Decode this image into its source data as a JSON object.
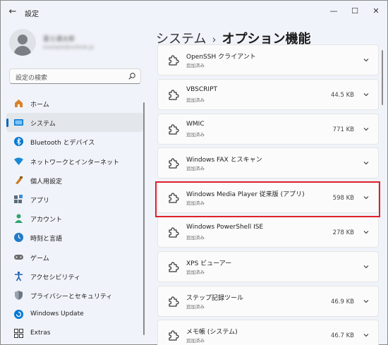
{
  "window": {
    "title": "設定",
    "minimize": "—",
    "maximize": "☐",
    "close": "✕",
    "back": "←"
  },
  "user": {
    "name": "富士通太郎",
    "email": "example@outlook.jp"
  },
  "search": {
    "placeholder": "設定の検索"
  },
  "nav": [
    {
      "label": "ホーム",
      "icon": "home-icon",
      "color": "#d9822b"
    },
    {
      "label": "システム",
      "icon": "system-icon",
      "color": "#0078d4",
      "active": true
    },
    {
      "label": "Bluetooth とデバイス",
      "icon": "bluetooth-icon",
      "color": "#0078d4"
    },
    {
      "label": "ネットワークとインターネット",
      "icon": "network-icon",
      "color": "#1a8ad4"
    },
    {
      "label": "個人用設定",
      "icon": "personalization-icon",
      "color": "#c97a22"
    },
    {
      "label": "アプリ",
      "icon": "apps-icon",
      "color": "#5a6b7b"
    },
    {
      "label": "アカウント",
      "icon": "account-icon",
      "color": "#2aa56b"
    },
    {
      "label": "時刻と言語",
      "icon": "time-language-icon",
      "color": "#1f7ac8"
    },
    {
      "label": "ゲーム",
      "icon": "gaming-icon",
      "color": "#6b6b6b"
    },
    {
      "label": "アクセシビリティ",
      "icon": "accessibility-icon",
      "color": "#1a5fb4"
    },
    {
      "label": "プライバシーとセキュリティ",
      "icon": "privacy-shield-icon",
      "color": "#6e7781"
    },
    {
      "label": "Windows Update",
      "icon": "windows-update-icon",
      "color": "#0078d4"
    },
    {
      "label": "Extras",
      "icon": "extras-icon",
      "color": "#333333"
    }
  ],
  "header": {
    "parent": "システム",
    "separator": "›",
    "current": "オプション機能"
  },
  "features": [
    {
      "name": "OpenSSH クライアント",
      "status": "追加済み",
      "size": ""
    },
    {
      "name": "VBSCRIPT",
      "status": "追加済み",
      "size": "44.5 KB"
    },
    {
      "name": "WMIC",
      "status": "追加済み",
      "size": "771 KB"
    },
    {
      "name": "Windows FAX とスキャン",
      "status": "追加済み",
      "size": ""
    },
    {
      "name": "Windows Media Player 従来版 (アプリ)",
      "status": "追加済み",
      "size": "598 KB",
      "highlighted": true
    },
    {
      "name": "Windows PowerShell ISE",
      "status": "追加済み",
      "size": "278 KB"
    },
    {
      "name": "XPS ビューアー",
      "status": "追加済み",
      "size": ""
    },
    {
      "name": "ステップ記録ツール",
      "status": "追加済み",
      "size": "46.9 KB"
    },
    {
      "name": "メモ帳 (システム)",
      "status": "追加済み",
      "size": "46.7 KB"
    }
  ]
}
